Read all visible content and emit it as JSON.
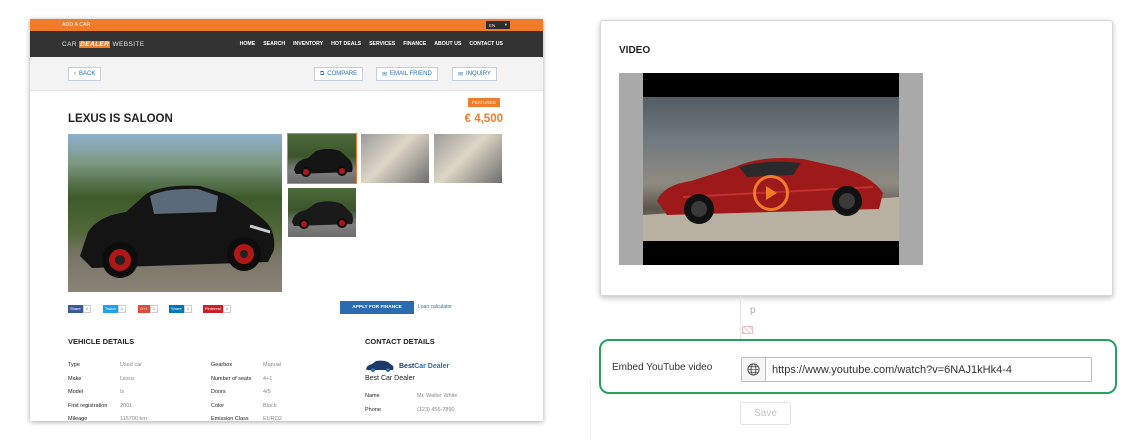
{
  "site": {
    "topbar": {
      "add_car": "ADD A CAR",
      "lang": "EN"
    },
    "logo": {
      "part1": "CAR ",
      "highlight": "DEALER",
      "part2": " WEBSITE"
    },
    "nav": [
      "HOME",
      "SEARCH",
      "INVENTORY",
      "HOT DEALS",
      "SERVICES",
      "FINANCE",
      "ABOUT US",
      "CONTACT US"
    ],
    "actions": {
      "back": "BACK",
      "compare": "COMPARE",
      "email": "EMAIL FRIEND",
      "inquiry": "INQUIRY"
    },
    "featured": "FEATURED",
    "title": "LEXUS IS SALOON",
    "price": "€ 4,500",
    "share": [
      {
        "label": "Share",
        "count": "0",
        "color": "#3b5998"
      },
      {
        "label": "Tweet",
        "count": "0",
        "color": "#1da1f2"
      },
      {
        "label": "G+1",
        "count": "0",
        "color": "#dd4b39"
      },
      {
        "label": "Share",
        "count": "0",
        "color": "#0077b5"
      },
      {
        "label": "Pinterest",
        "count": "0",
        "color": "#cb2027"
      }
    ],
    "finance_button": "APPLY FOR FINANCE",
    "loan_link": "Loan calculator",
    "vehicle_details": {
      "heading": "VEHICLE DETAILS",
      "col1": [
        {
          "label": "Type",
          "value": "Used car"
        },
        {
          "label": "Make",
          "value": "Lexus"
        },
        {
          "label": "Model",
          "value": "Is"
        },
        {
          "label": "First registration",
          "value": "2001"
        },
        {
          "label": "Mileage",
          "value": "115700 km"
        }
      ],
      "col2": [
        {
          "label": "Gearbox",
          "value": "Manual"
        },
        {
          "label": "Number of seats",
          "value": "4+1"
        },
        {
          "label": "Doors",
          "value": "4/5"
        },
        {
          "label": "Color",
          "value": "Black"
        },
        {
          "label": "Emission Class",
          "value": "EURO2"
        }
      ]
    },
    "contact": {
      "heading": "CONTACT DETAILS",
      "brand_a": "Best",
      "brand_b": "Car Dealer",
      "dealer_name": "Best Car Dealer",
      "rows": [
        {
          "label": "Name",
          "value": "Mr. Walter White"
        },
        {
          "label": "Phone",
          "value": "(123) 456-7890"
        }
      ]
    }
  },
  "panel": {
    "heading": "VIDEO"
  },
  "editor": {
    "placeholder_letter": "p",
    "embed_label": "Embed YouTube video",
    "embed_value": "https://www.youtube.com/watch?v=6NAJ1kHk4-4",
    "save": "Save"
  },
  "colors": {
    "accent": "#f07b29",
    "link_blue": "#2b6cb0",
    "highlight_green": "#27a05a",
    "nav_dark": "#333333"
  }
}
